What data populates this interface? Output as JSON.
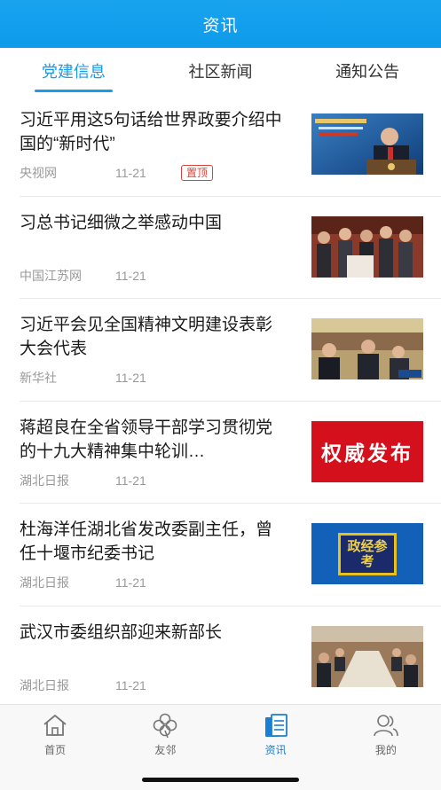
{
  "header": {
    "title": "资讯"
  },
  "tabs": [
    {
      "label": "党建信息",
      "active": true
    },
    {
      "label": "社区新闻",
      "active": false
    },
    {
      "label": "通知公告",
      "active": false
    }
  ],
  "news": [
    {
      "title": "习近平用这5句话给世界政要介绍中国的“新时代”",
      "source": "央视网",
      "date": "11-21",
      "badge": "置顶",
      "image": "president-speech-photo"
    },
    {
      "title": "习总书记细微之举感动中国",
      "source": "中国江苏网",
      "date": "11-21",
      "badge": "",
      "image": "meeting-crowd-photo"
    },
    {
      "title": "习近平会见全国精神文明建设表彰大会代表",
      "source": "新华社",
      "date": "11-21",
      "badge": "",
      "image": "handshake-meeting-photo"
    },
    {
      "title": "蒋超良在全省领导干部学习贯彻党的十九大精神集中轮训…",
      "source": "湖北日报",
      "date": "11-21",
      "badge": "",
      "image": "authority-release-banner",
      "image_text": "权威发布"
    },
    {
      "title": "杜海洋任湖北省发改委副主任，曾任十堰市纪委书记",
      "source": "湖北日报",
      "date": "11-21",
      "badge": "",
      "image": "politics-economy-banner",
      "image_text": "政经参考"
    },
    {
      "title": "武汉市委组织部迎来新部长",
      "source": "湖北日报",
      "date": "11-21",
      "badge": "",
      "image": "conference-room-photo"
    }
  ],
  "tabbar": [
    {
      "label": "首页",
      "icon": "home-icon",
      "active": false
    },
    {
      "label": "友邻",
      "icon": "clover-icon",
      "active": false
    },
    {
      "label": "资讯",
      "icon": "news-icon",
      "active": true
    },
    {
      "label": "我的",
      "icon": "user-icon",
      "active": false
    }
  ],
  "colors": {
    "accent": "#1a9cec",
    "badge": "#d9453a",
    "header": "#19a3ef"
  }
}
